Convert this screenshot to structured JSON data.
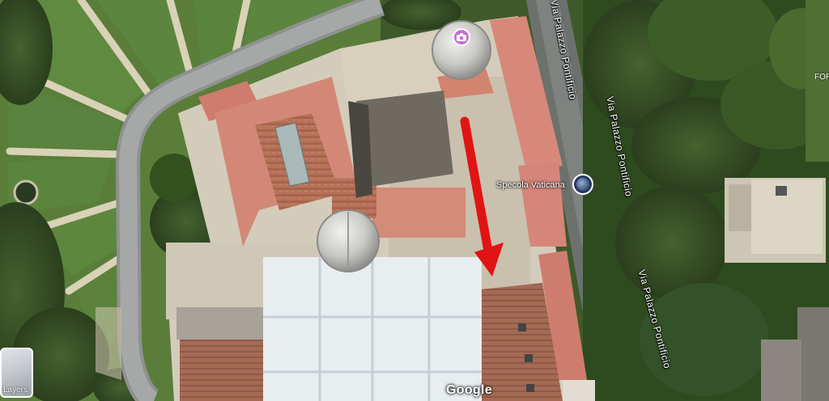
{
  "map": {
    "type": "satellite",
    "provider": "Google"
  },
  "labels": {
    "road_top": "Via Palazzo Pontificio",
    "road_mid": "Via Palazzo Pontificio",
    "road_bottom": "Via Palazzo Pontificio",
    "poi": "Specola Vaticana",
    "edge": "FOR"
  },
  "controls": {
    "layers_label": "Layers"
  },
  "branding": {
    "logo": "Google"
  },
  "annotations": {
    "arrow_color": "#e01414"
  },
  "icons": {
    "poi_pin": "observatory-pin-icon",
    "photo_pin": "camera-icon"
  }
}
